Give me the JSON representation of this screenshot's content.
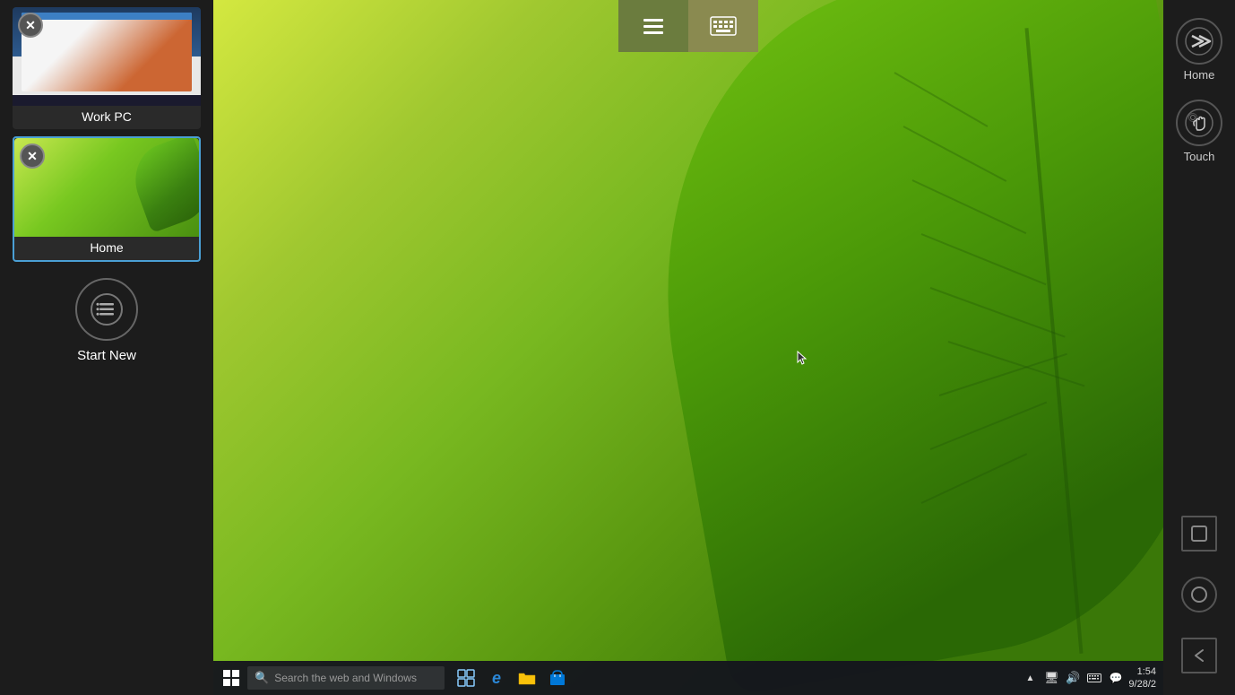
{
  "sidebar": {
    "sessions": [
      {
        "id": "work-pc",
        "label": "Work PC",
        "active": false,
        "type": "workpc"
      },
      {
        "id": "home",
        "label": "Home",
        "active": true,
        "type": "home"
      }
    ],
    "start_new_label": "Start New"
  },
  "toolbar": {
    "menu_icon": "☰",
    "keyboard_icon": "⌨"
  },
  "right_panel": {
    "home_label": "Home",
    "touch_label": "Touch",
    "nav_square": "□",
    "nav_circle": "○",
    "nav_back": "◁"
  },
  "taskbar": {
    "start_icon": "⊞",
    "search_placeholder": "Search the web and Windows",
    "apps": [
      {
        "id": "task-view",
        "icon": "⧉"
      },
      {
        "id": "edge",
        "icon": "e"
      },
      {
        "id": "explorer",
        "icon": "📁"
      },
      {
        "id": "store",
        "icon": "🛍"
      }
    ],
    "time": "1:54",
    "date": "9/28/2"
  }
}
